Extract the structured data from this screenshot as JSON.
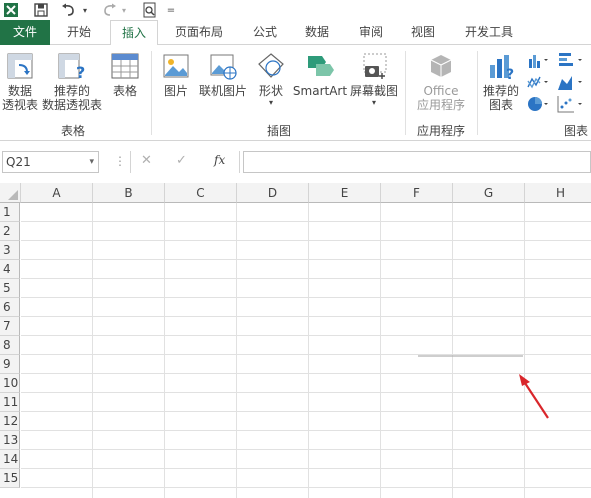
{
  "quick_access": {
    "excel_icon": "excel-logo-icon",
    "save_icon": "save-icon",
    "undo_icon": "undo-icon",
    "redo_icon": "redo-icon",
    "preview_icon": "print-preview-icon",
    "customize_label": "="
  },
  "tabs": [
    {
      "label": "文件"
    },
    {
      "label": "开始"
    },
    {
      "label": "插入"
    },
    {
      "label": "页面布局"
    },
    {
      "label": "公式"
    },
    {
      "label": "数据"
    },
    {
      "label": "审阅"
    },
    {
      "label": "视图"
    },
    {
      "label": "开发工具"
    }
  ],
  "ribbon": {
    "groups": {
      "tables": "表格",
      "illustrations": "插图",
      "apps": "应用程序",
      "charts": "图表"
    },
    "buttons": {
      "pivot_line1": "数据",
      "pivot_line2": "透视表",
      "rec_pivot_line1": "推荐的",
      "rec_pivot_line2": "数据透视表",
      "table": "表格",
      "pictures": "图片",
      "online_pictures": "联机图片",
      "shapes": "形状",
      "smartart": "SmartArt",
      "screenshot": "屏幕截图",
      "office_line1": "Office",
      "office_line2": "应用程序",
      "rec_charts_line1": "推荐的",
      "rec_charts_line2": "图表"
    }
  },
  "formula_bar": {
    "name_box": "Q21",
    "cancel_glyph": "✕",
    "enter_glyph": "✓",
    "fx_label": "fx",
    "formula": ""
  },
  "sheet": {
    "columns": [
      "A",
      "B",
      "C",
      "D",
      "E",
      "F",
      "G",
      "H"
    ],
    "rows": [
      "1",
      "2",
      "3",
      "4",
      "5",
      "6",
      "7",
      "8",
      "9",
      "10",
      "11",
      "12",
      "13",
      "14",
      "15"
    ]
  },
  "colors": {
    "excel_green": "#217346",
    "arrow_red": "#d9262b"
  }
}
